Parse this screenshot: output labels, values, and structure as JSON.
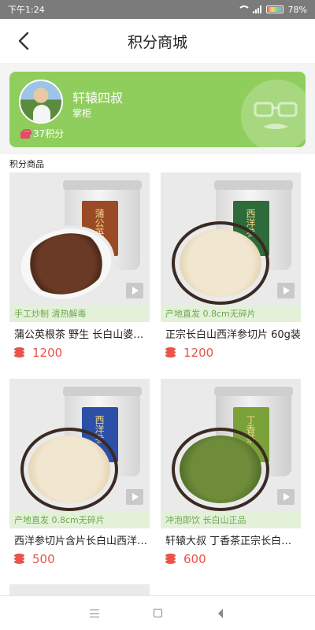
{
  "status_bar": {
    "time": "下午1:24",
    "battery": "78%"
  },
  "nav": {
    "title": "积分商城",
    "back_icon": "chevron-left-icon"
  },
  "profile": {
    "name": "轩辕四叔",
    "role": "掌柜",
    "points": "37积分",
    "points_icon": "gift-icon"
  },
  "section_title": "积分商品",
  "colors": {
    "accent": "#8fce5c",
    "price": "#e8534a",
    "tag_bg": "#e3f1d9",
    "tag_text": "#6ea84e"
  },
  "products": [
    {
      "tag": "手工炒制 清热解毒",
      "name": "蒲公英根茶 野生 长白山婆婆丁根茶",
      "price": "1200",
      "jar_label": "蒲公英根"
    },
    {
      "tag": "产地直发 0.8cm无碎片",
      "name": "正宗长白山西洋参切片 60g装",
      "price": "1200",
      "jar_label": "西洋参"
    },
    {
      "tag": "产地直发 0.8cm无碎片",
      "name": "西洋参切片含片长白山西洋参片",
      "price": "500",
      "jar_label": "西洋参"
    },
    {
      "tag": "冲泡即饮 长白山正品",
      "name": "轩辕大叔 丁香茶正宗长白山丁香叶",
      "price": "600",
      "jar_label": "丁香茶"
    }
  ]
}
